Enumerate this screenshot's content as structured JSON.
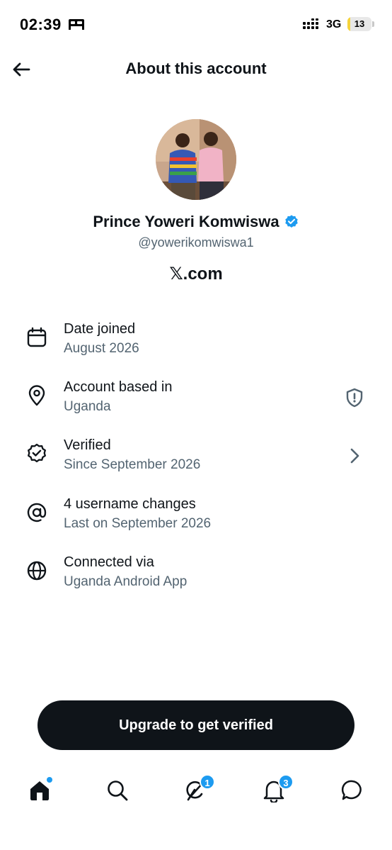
{
  "status_bar": {
    "time": "02:39",
    "network": "3G",
    "battery": "13",
    "battery_level": 0.13,
    "icons": [
      "sleep-bed-icon",
      "cellular-signal-icon",
      "battery-icon"
    ]
  },
  "header": {
    "title": "About this account",
    "back_icon": "arrow-left-icon"
  },
  "profile": {
    "display_name": "Prince Yoweri Komwiswa",
    "handle": "@yowerikomwiswa1",
    "domain": "𝕏.com",
    "verified_badge_color": "#1d9bf0"
  },
  "info": [
    {
      "icon": "calendar-icon",
      "title": "Date joined",
      "subtitle": "August 2026"
    },
    {
      "icon": "location-pin-icon",
      "title": "Account based in",
      "subtitle": "Uganda",
      "right_icon": "shield-alert-icon"
    },
    {
      "icon": "verified-check-icon",
      "title": "Verified",
      "subtitle": "Since September 2026",
      "right_icon": "chevron-right-icon"
    },
    {
      "icon": "at-sign-icon",
      "title": "4 username changes",
      "subtitle": "Last on September 2026"
    },
    {
      "icon": "globe-icon",
      "title": "Connected via",
      "subtitle": "Uganda Android App"
    }
  ],
  "cta": {
    "label": "Upgrade to get verified"
  },
  "bottom_nav": [
    {
      "icon": "home-icon",
      "active": true,
      "dot": true
    },
    {
      "icon": "search-icon"
    },
    {
      "icon": "grok-icon",
      "badge": "1"
    },
    {
      "icon": "bell-icon",
      "badge": "3"
    },
    {
      "icon": "messages-icon"
    }
  ],
  "colors": {
    "text": "#0f1419",
    "secondary_text": "#536471",
    "accent": "#1d9bf0",
    "button_bg": "#0f1419",
    "battery_fill": "#f5d33b"
  }
}
